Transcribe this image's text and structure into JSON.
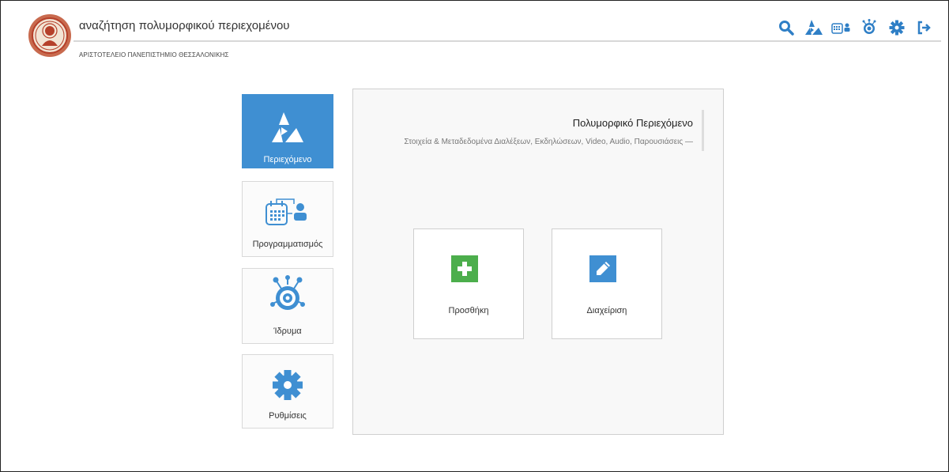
{
  "header": {
    "app_title": "αναζήτηση πολυμορφικού περιεχομένου",
    "university": "ΑΡΙΣΤΟΤΕΛΕΙΟ ΠΑΝΕΠΙΣΤΗΜΙΟ ΘΕΣΣΑΛΟΝΙΚΗΣ",
    "icons": [
      "search-icon",
      "content-icon",
      "schedule-icon",
      "institution-icon",
      "gear-icon",
      "logout-icon"
    ]
  },
  "sidebar": {
    "items": [
      {
        "label": "Περιεχόμενο",
        "icon": "content-icon",
        "active": true
      },
      {
        "label": "Προγραμματισμός",
        "icon": "schedule-icon",
        "active": false
      },
      {
        "label": "Ίδρυμα",
        "icon": "institution-icon",
        "active": false
      },
      {
        "label": "Ρυθμίσεις",
        "icon": "gear-icon",
        "active": false
      }
    ]
  },
  "panel": {
    "title": "Πολυμορφικό Περιεχόμενο",
    "subtitle": "Στοιχεία & Μεταδεδομένα Διαλέξεων, Εκδηλώσεων, Video, Audio, Παρουσιάσεις —",
    "actions": [
      {
        "label": "Προσθήκη",
        "icon": "plus-icon",
        "color": "#4cae4c"
      },
      {
        "label": "Διαχείριση",
        "icon": "pencil-icon",
        "color": "#3f8fd2"
      }
    ]
  },
  "colors": {
    "accent": "#3f8fd2",
    "success": "#4cae4c",
    "logo": "#b5402a"
  }
}
